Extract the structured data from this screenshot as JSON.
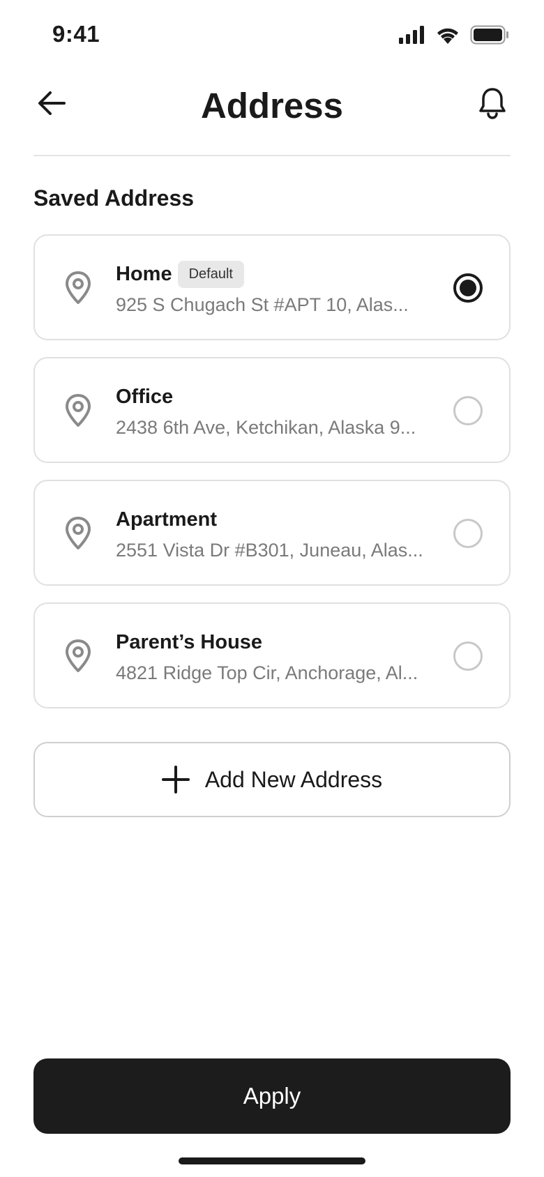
{
  "status_bar": {
    "time": "9:41",
    "icons": [
      "cellular-signal-icon",
      "wifi-icon",
      "battery-icon"
    ]
  },
  "header": {
    "title": "Address",
    "back_icon": "arrow-left-icon",
    "bell_icon": "bell-icon"
  },
  "section_title": "Saved Address",
  "addresses": [
    {
      "label": "Home",
      "badge": "Default",
      "address": "925 S Chugach St #APT 10, Alas...",
      "selected": true
    },
    {
      "label": "Office",
      "address": "2438 6th Ave, Ketchikan, Alaska 9...",
      "selected": false
    },
    {
      "label": "Apartment",
      "address": "2551 Vista Dr #B301, Juneau, Alas...",
      "selected": false
    },
    {
      "label": "Parent’s House",
      "address": "4821 Ridge Top Cir, Anchorage, Al...",
      "selected": false
    }
  ],
  "add_button": {
    "label": "Add New Address",
    "icon": "plus-icon"
  },
  "apply_button": {
    "label": "Apply"
  },
  "colors": {
    "primary": "#1c1c1c",
    "muted_text": "#7a7a7a",
    "border": "#e0e0e0",
    "badge_bg": "#e8e8e8"
  }
}
